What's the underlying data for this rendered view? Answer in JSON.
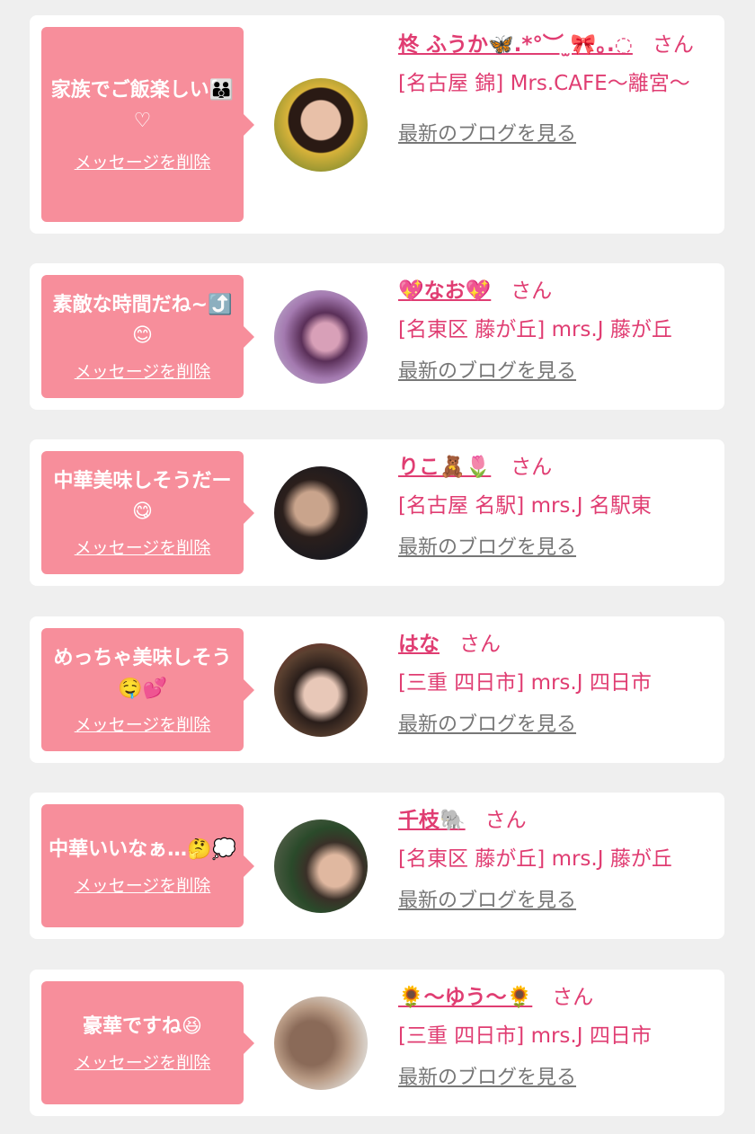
{
  "delete_label": "メッセージを削除",
  "blog_label": "最新のブログを見る",
  "san_label": "さん",
  "colors": {
    "accent": "#f78e9b",
    "name": "#e03d72",
    "blog": "#777777",
    "background": "#efefef"
  },
  "items": [
    {
      "message": "家族でご飯楽しい👪♡",
      "name": "柊 ふうか🦋.*°︶ ̫🎀｡.◌",
      "shop": "[名古屋 錦] Mrs.CAFE～離宮～"
    },
    {
      "message": "素敵な時間だね~⤴️😊",
      "name": "💖なお💖",
      "shop": "[名東区 藤が丘] mrs.J 藤が丘"
    },
    {
      "message": "中華美味しそうだー😋",
      "name": "りこ🧸🌷",
      "shop": "[名古屋 名駅] mrs.J 名駅東"
    },
    {
      "message": "めっちゃ美味しそう🤤💕",
      "name": "はな",
      "shop": "[三重 四日市] mrs.J 四日市"
    },
    {
      "message": "中華いいなぁ…🤔💭",
      "name": "千枝🐘",
      "shop": "[名東区 藤が丘] mrs.J 藤が丘"
    },
    {
      "message": "豪華ですね😆",
      "name": "🌻〜ゆう〜🌻",
      "shop": "[三重 四日市] mrs.J 四日市"
    }
  ]
}
